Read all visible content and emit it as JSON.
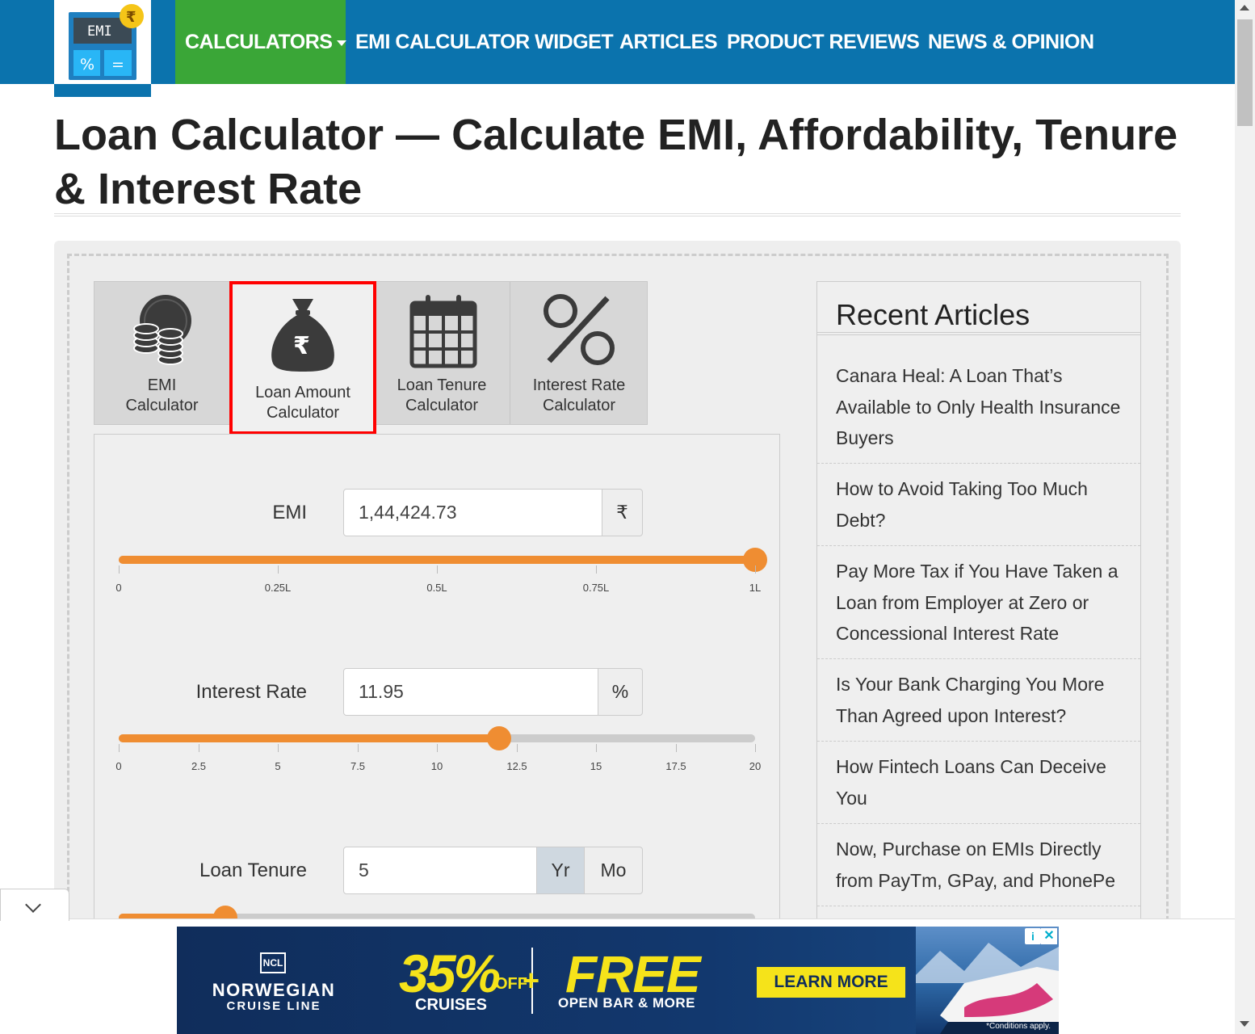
{
  "header": {
    "logo_text": "EMI",
    "logo_badge": "₹",
    "logo_ops": [
      "%",
      "="
    ],
    "nav": [
      {
        "label": "CALCULATORS"
      },
      {
        "label": "EMI CALCULATOR WIDGET"
      },
      {
        "label": "ARTICLES"
      },
      {
        "label": "PRODUCT REVIEWS"
      },
      {
        "label": "NEWS & OPINION"
      }
    ]
  },
  "page": {
    "title": "Loan Calculator — Calculate EMI, Affordability, Tenure & Interest Rate"
  },
  "tabs": [
    {
      "label_line1": "EMI",
      "label_line2": "Calculator",
      "icon": "coins-icon",
      "active": false
    },
    {
      "label_line1": "Loan Amount",
      "label_line2": "Calculator",
      "icon": "money-bag-icon",
      "active": true
    },
    {
      "label_line1": "Loan Tenure",
      "label_line2": "Calculator",
      "icon": "calendar-icon",
      "active": false
    },
    {
      "label_line1": "Interest Rate",
      "label_line2": "Calculator",
      "icon": "percent-icon",
      "active": false
    }
  ],
  "form": {
    "emi": {
      "label": "EMI",
      "value": "1,44,424.73",
      "addon": "₹",
      "slider_fraction": 1.0,
      "ticks": [
        "0",
        "0.25L",
        "0.5L",
        "0.75L",
        "1L"
      ]
    },
    "interest": {
      "label": "Interest Rate",
      "value": "11.95",
      "addon": "%",
      "slider_value": 11.95,
      "slider_max": 20,
      "ticks": [
        "0",
        "2.5",
        "5",
        "7.5",
        "10",
        "12.5",
        "15",
        "17.5",
        "20"
      ]
    },
    "tenure": {
      "label": "Loan Tenure",
      "value": "5",
      "unit_year": "Yr",
      "unit_month": "Mo",
      "selected_unit": "Yr",
      "slider_fraction": 0.168
    }
  },
  "sidebar": {
    "title": "Recent Articles",
    "articles": [
      "Canara Heal: A Loan That’s Available to Only Health Insurance Buyers",
      "How to Avoid Taking Too Much Debt?",
      "Pay More Tax if You Have Taken a Loan from Employer at Zero or Concessional Interest Rate",
      "Is Your Bank Charging You More Than Agreed upon Interest?",
      "How Fintech Loans Can Deceive You",
      "Now, Purchase on EMIs Directly from PayTm, GPay, and PhonePe"
    ]
  },
  "ad": {
    "brand_logo": "NCL",
    "brand_line1": "NORWEGIAN",
    "brand_line2": "CRUISE LINE",
    "offer_pct": "35%",
    "offer_off": "OFF",
    "offer_cruises": "CRUISES",
    "plus": "+",
    "free": "FREE",
    "free_sub": "OPEN BAR & MORE",
    "cta": "LEARN MORE",
    "conditions": "*Conditions apply.",
    "info_icon": "i",
    "close_icon": "✕"
  },
  "colors": {
    "header_blue": "#0b73ad",
    "nav_active_green": "#3aa637",
    "slider_orange": "#ef8d32",
    "active_tab_border": "#ff0000",
    "ad_yellow": "#f5e31a"
  }
}
